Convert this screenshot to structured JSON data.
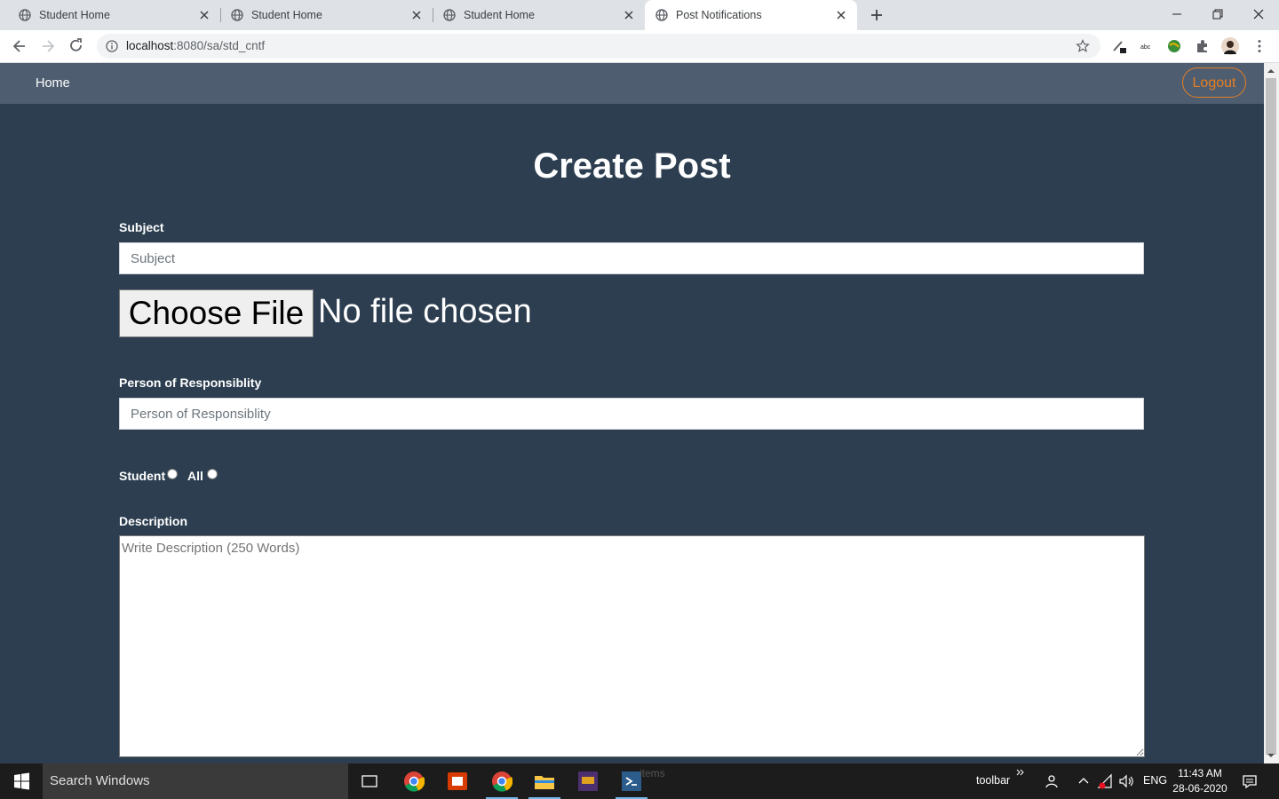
{
  "browser": {
    "tabs": [
      {
        "title": "Student Home",
        "active": false
      },
      {
        "title": "Student Home",
        "active": false
      },
      {
        "title": "Student Home",
        "active": false
      },
      {
        "title": "Post Notifications",
        "active": true
      }
    ],
    "url_host": "localhost",
    "url_path": ":8080/sa/std_cntf"
  },
  "navbar": {
    "home_label": "Home",
    "logout_label": "Logout",
    "accent_color": "#e67e22"
  },
  "form": {
    "title": "Create Post",
    "subject_label": "Subject",
    "subject_placeholder": "Subject",
    "file_button_label": "Choose File",
    "file_status": "No file chosen",
    "responsibility_label": "Person of Responsiblity",
    "responsibility_placeholder": "Person of Responsiblity",
    "audience_options": [
      "Student",
      "All"
    ],
    "description_label": "Description",
    "description_placeholder": "Write Description (250 Words)"
  },
  "taskbar": {
    "search_placeholder": "Search Windows",
    "toolbar_label": "toolbar",
    "language": "ENG",
    "time": "11:43 AM",
    "date": "28-06-2020",
    "faint_text": "items"
  }
}
